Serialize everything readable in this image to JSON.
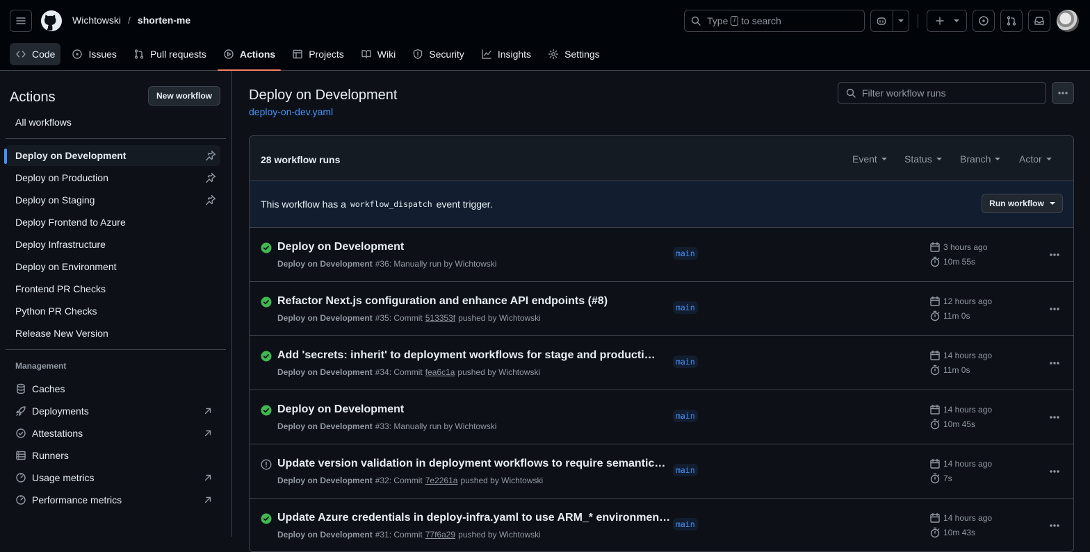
{
  "header": {
    "owner": "Wichtowski",
    "separator": "/",
    "repo": "shorten-me",
    "search_prefix": "Type",
    "search_key": "/",
    "search_suffix": "to search"
  },
  "tabs": [
    {
      "label": "Code",
      "icon": "code-icon"
    },
    {
      "label": "Issues",
      "icon": "issue-icon"
    },
    {
      "label": "Pull requests",
      "icon": "pull-request-icon"
    },
    {
      "label": "Actions",
      "icon": "play-icon"
    },
    {
      "label": "Projects",
      "icon": "table-icon"
    },
    {
      "label": "Wiki",
      "icon": "book-icon"
    },
    {
      "label": "Security",
      "icon": "shield-icon"
    },
    {
      "label": "Insights",
      "icon": "graph-icon"
    },
    {
      "label": "Settings",
      "icon": "gear-icon"
    }
  ],
  "sidebar": {
    "title": "Actions",
    "new_workflow": "New workflow",
    "all_workflows": "All workflows",
    "workflows": [
      "Deploy on Development",
      "Deploy on Production",
      "Deploy on Staging",
      "Deploy Frontend to Azure",
      "Deploy Infrastructure",
      "Deploy on Environment",
      "Frontend PR Checks",
      "Python PR Checks",
      "Release New Version"
    ],
    "management_heading": "Management",
    "management": [
      {
        "label": "Caches",
        "icon": "database-icon"
      },
      {
        "label": "Deployments",
        "icon": "rocket-icon"
      },
      {
        "label": "Attestations",
        "icon": "verified-icon"
      },
      {
        "label": "Runners",
        "icon": "server-icon"
      },
      {
        "label": "Usage metrics",
        "icon": "meter-icon"
      },
      {
        "label": "Performance metrics",
        "icon": "meter-icon"
      }
    ]
  },
  "main": {
    "title": "Deploy on Development",
    "file": "deploy-on-dev.yaml",
    "filter_placeholder": "Filter workflow runs",
    "run_count": "28 workflow runs",
    "filters": [
      "Event",
      "Status",
      "Branch",
      "Actor"
    ],
    "dispatch_pre": "This workflow has a",
    "dispatch_code": "workflow_dispatch",
    "dispatch_post": "event trigger.",
    "run_workflow": "Run workflow",
    "runs": [
      {
        "status": "success",
        "title": "Deploy on Development",
        "workflow": "Deploy on Development",
        "number": "#36",
        "trigger": ": Manually run by Wichtowski",
        "sha": "",
        "after": "",
        "branch": "main",
        "when": "3 hours ago",
        "duration": "10m 55s"
      },
      {
        "status": "success",
        "title": "Refactor Next.js configuration and enhance API endpoints (#8)",
        "workflow": "Deploy on Development",
        "number": "#35",
        "trigger": ": Commit",
        "sha": "513353f",
        "after": "pushed by Wichtowski",
        "branch": "main",
        "when": "12 hours ago",
        "duration": "11m 0s"
      },
      {
        "status": "success",
        "title": "Add 'secrets: inherit' to deployment workflows for stage and producti…",
        "workflow": "Deploy on Development",
        "number": "#34",
        "trigger": ": Commit",
        "sha": "fea6c1a",
        "after": "pushed by Wichtowski",
        "branch": "main",
        "when": "14 hours ago",
        "duration": "11m 0s"
      },
      {
        "status": "success",
        "title": "Deploy on Development",
        "workflow": "Deploy on Development",
        "number": "#33",
        "trigger": ": Manually run by Wichtowski",
        "sha": "",
        "after": "",
        "branch": "main",
        "when": "14 hours ago",
        "duration": "10m 45s"
      },
      {
        "status": "startup_failure",
        "title": "Update version validation in deployment workflows to require semantic…",
        "workflow": "Deploy on Development",
        "number": "#32",
        "trigger": ": Commit",
        "sha": "7e2261a",
        "after": "pushed by Wichtowski",
        "branch": "main",
        "when": "14 hours ago",
        "duration": "7s"
      },
      {
        "status": "success",
        "title": "Update Azure credentials in deploy-infra.yaml to use ARM_* environmen…",
        "workflow": "Deploy on Development",
        "number": "#31",
        "trigger": ": Commit",
        "sha": "77f6a29",
        "after": "pushed by Wichtowski",
        "branch": "main",
        "when": "14 hours ago",
        "duration": "10m 43s"
      }
    ]
  },
  "colors": {
    "accent": "#4493f8",
    "success": "#3fb950",
    "tab_underline": "#f78166"
  }
}
